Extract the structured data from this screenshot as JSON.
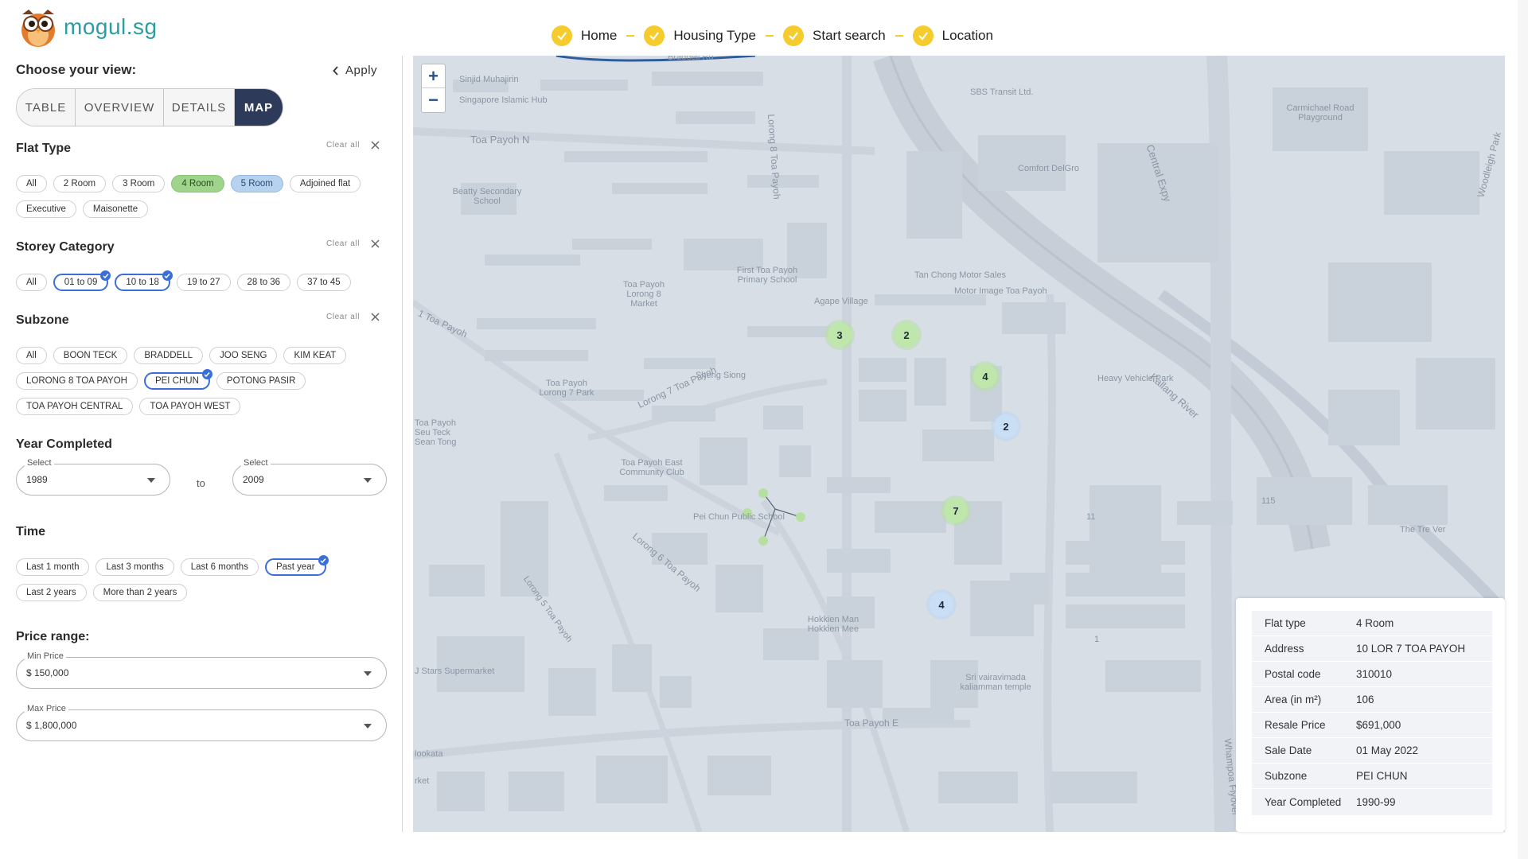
{
  "brand": {
    "name": "mogul.sg"
  },
  "steps": [
    {
      "label": "Home"
    },
    {
      "label": "Housing Type"
    },
    {
      "label": "Start search"
    },
    {
      "label": "Location"
    }
  ],
  "sidebar": {
    "view_title": "Choose your view:",
    "apply_label": "Apply",
    "views": [
      "TABLE",
      "OVERVIEW",
      "DETAILS",
      "MAP"
    ],
    "active_view": "MAP",
    "clear_all_label": "Clear all",
    "flat_type": {
      "title": "Flat Type",
      "options": [
        "All",
        "2 Room",
        "3 Room",
        "4 Room",
        "5 Room",
        "Adjoined flat",
        "Executive",
        "Maisonette"
      ],
      "selected": [
        "4 Room",
        "5 Room"
      ]
    },
    "storey": {
      "title": "Storey Category",
      "options": [
        "All",
        "01 to 09",
        "10 to 18",
        "19 to 27",
        "28 to 36",
        "37 to 45"
      ],
      "selected": [
        "01 to 09",
        "10 to 18"
      ]
    },
    "subzone": {
      "title": "Subzone",
      "options": [
        "All",
        "BOON TECK",
        "BRADDELL",
        "JOO SENG",
        "KIM KEAT",
        "LORONG 8 TOA PAYOH",
        "PEI CHUN",
        "POTONG PASIR",
        "TOA PAYOH CENTRAL",
        "TOA PAYOH WEST"
      ],
      "selected": [
        "PEI CHUN"
      ]
    },
    "year_completed": {
      "title": "Year Completed",
      "from_label": "Select",
      "from_value": "1989",
      "to_text": "to",
      "to_label": "Select",
      "to_value": "2009"
    },
    "time": {
      "title": "Time",
      "options": [
        "Last 1 month",
        "Last 3 months",
        "Last 6 months",
        "Past year",
        "Last 2 years",
        "More than 2 years"
      ],
      "selected": [
        "Past year"
      ]
    },
    "price": {
      "title": "Price range:",
      "min_label": "Min Price",
      "min_value": "$ 150,000",
      "max_label": "Max Price",
      "max_value": "$ 1,800,000"
    }
  },
  "map": {
    "zoom_in": "+",
    "zoom_out": "−",
    "labels": [
      "Sinjid Muhajirin",
      "Singapore Islamic Hub",
      "Toa Payoh N",
      "Beatty Secondary School",
      "SBS Transit Ltd.",
      "Comfort DelGro",
      "Carmichael Road Playground",
      "Woodleigh Park",
      "Central Expy",
      "Lorong 8 Toa Payoh",
      "First Toa Payoh Primary School",
      "Toa Payoh Lorong 8 Market",
      "Agape Village",
      "Tan Chong Motor Sales",
      "Motor Image Toa Payoh",
      "Kallang River",
      "Heavy Vehicle Park",
      "Lorong 7 Toa Payoh",
      "Sheng Siong",
      "Toa Payoh Lorong 7 Park",
      "Toa Payoh Seu Teck Sean Tong",
      "Toa Payoh East Community Club",
      "Pei Chun Public School",
      "Lorong 6 Toa Payoh",
      "Lorong 5 Toa Payoh",
      "Hokkien Man Hokkien Mee",
      "Sri vairavimada kaliamman temple",
      "Toa Payoh E",
      "Whampoa Flyover",
      "The Tre Ver",
      "J Stars Supermarket",
      "lookata",
      "rket",
      "Braddell Rd",
      "1 Toa Payoh",
      "11",
      "115",
      "1"
    ],
    "markers": [
      {
        "count": "3",
        "color": "green"
      },
      {
        "count": "2",
        "color": "green"
      },
      {
        "count": "4",
        "color": "green"
      },
      {
        "count": "2",
        "color": "blue"
      },
      {
        "count": "7",
        "color": "green"
      },
      {
        "count": "4",
        "color": "blue"
      }
    ]
  },
  "info_panel": {
    "rows": [
      {
        "k": "Flat type",
        "v": "4 Room"
      },
      {
        "k": "Address",
        "v": "10 LOR 7 TOA PAYOH"
      },
      {
        "k": "Postal code",
        "v": "310010"
      },
      {
        "k": "Area (in m²)",
        "v": "106"
      },
      {
        "k": "Resale Price",
        "v": "$691,000"
      },
      {
        "k": "Sale Date",
        "v": "01 May 2022"
      },
      {
        "k": "Subzone",
        "v": "PEI CHUN"
      },
      {
        "k": "Year Completed",
        "v": "1990-99"
      }
    ]
  }
}
